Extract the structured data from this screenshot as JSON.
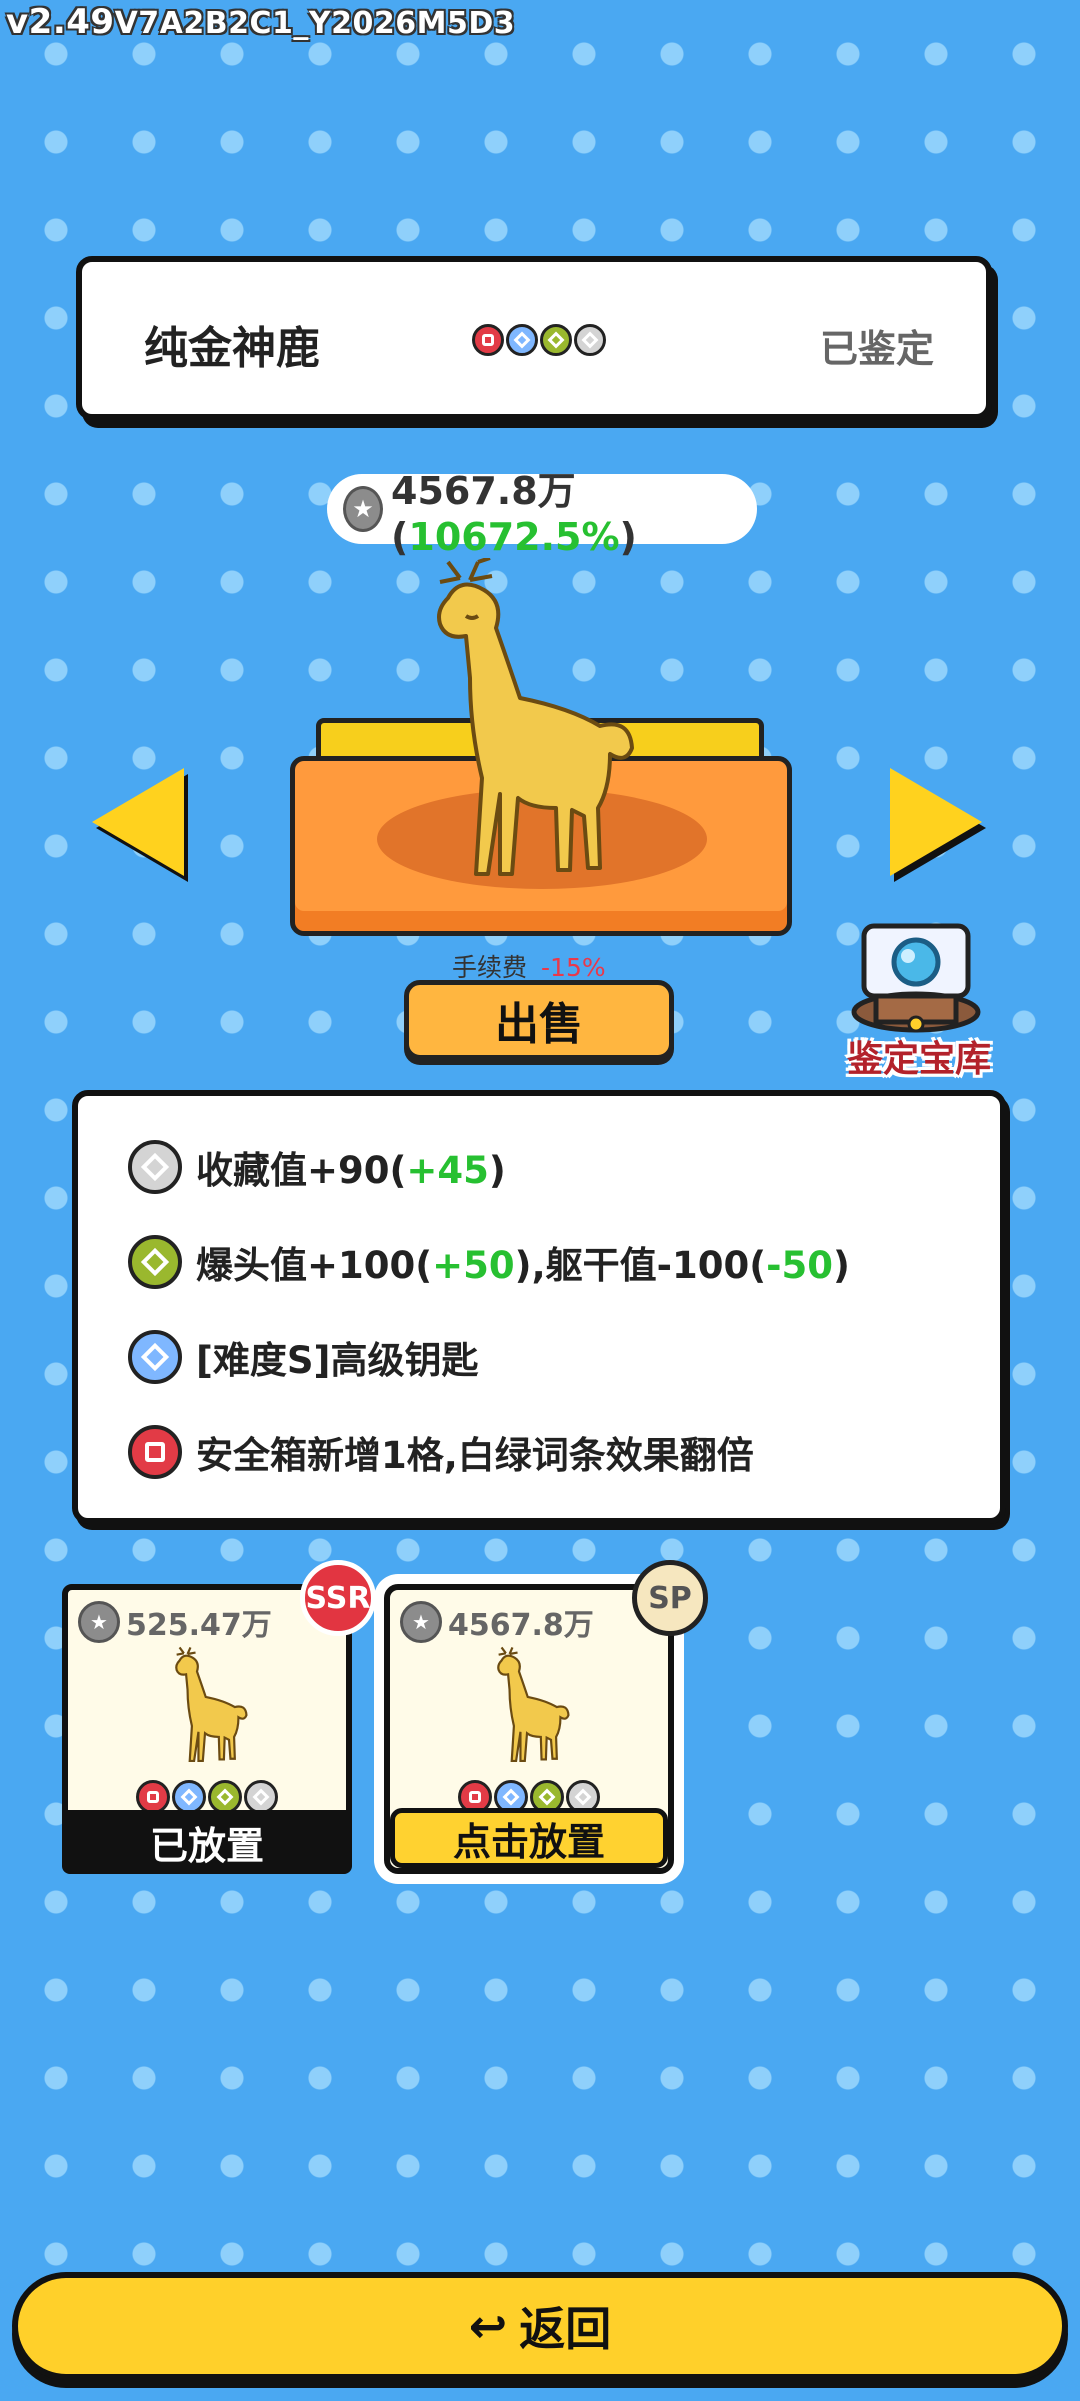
{
  "version": {
    "prefix": "v2.49",
    "suffix": "V7A2B2C1_Y2026M5D3"
  },
  "item": {
    "name": "纯金神鹿",
    "status": "已鉴定",
    "gems": [
      "red",
      "blue",
      "green",
      "gray"
    ]
  },
  "price": {
    "icon": "coin-icon",
    "value": "4567.8万",
    "open": "(",
    "percent": "10672.5%",
    "close": ")"
  },
  "fee": {
    "label": "手续费",
    "value": "-15%"
  },
  "sell_label": "出售",
  "vault_label": "鉴定宝库",
  "effects": [
    {
      "gem": "gray",
      "text": "收藏值+90(",
      "bonus": "+45",
      "tail": ")"
    },
    {
      "gem": "green",
      "text": "爆头值+100(",
      "bonus": "+50",
      "mid": "),躯干值-100(",
      "bonus2": "-50",
      "tail": ")"
    },
    {
      "gem": "blue",
      "text": "[难度S]高级钥匙"
    },
    {
      "gem": "red",
      "text": "安全箱新增1格,白绿词条效果翻倍"
    }
  ],
  "cards": [
    {
      "price": "525.47万",
      "badge": "SSR",
      "action": "已放置",
      "gems": [
        "red",
        "blue",
        "green",
        "gray"
      ]
    },
    {
      "price": "4567.8万",
      "badge": "SP",
      "action": "点击放置",
      "gems": [
        "red",
        "blue",
        "green",
        "gray"
      ]
    }
  ],
  "back_label": "返回",
  "colors": {
    "background": "#4aa8f2",
    "accent": "#ffd02a",
    "positive": "#27c031",
    "negative": "#e9394b"
  }
}
